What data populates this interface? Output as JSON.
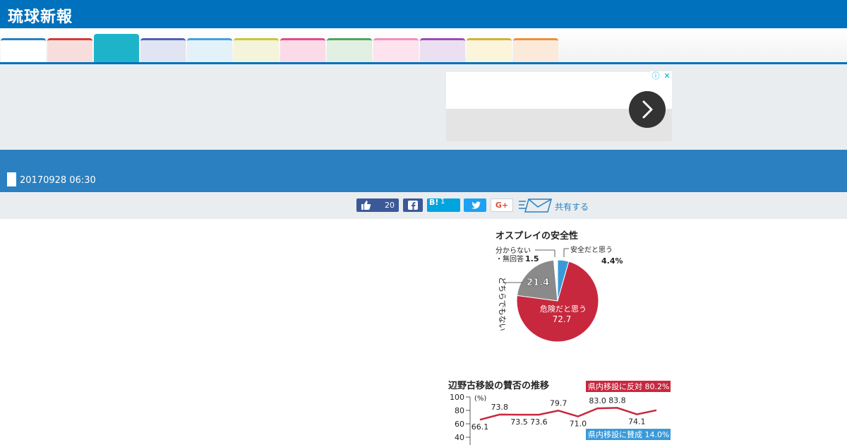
{
  "header": {
    "logo": "琉球新報"
  },
  "nav": {
    "tabs": [
      {
        "color": "#ffffff",
        "border": "#2a80c0"
      },
      {
        "color": "#f7dedd",
        "border": "#d33b3b"
      },
      {
        "color": "#1db4c9",
        "border": "#1db4c9",
        "active": true
      },
      {
        "color": "#e1e4f2",
        "border": "#5062b0"
      },
      {
        "color": "#e3f1f8",
        "border": "#4a9fd6"
      },
      {
        "color": "#f3f4d9",
        "border": "#c8c83a"
      },
      {
        "color": "#fadbe7",
        "border": "#e04c87"
      },
      {
        "color": "#e1f0e3",
        "border": "#4ea85c"
      },
      {
        "color": "#fde3ee",
        "border": "#f190b8"
      },
      {
        "color": "#ebe0f1",
        "border": "#9b4cb6"
      },
      {
        "color": "#fbf5dc",
        "border": "#d2b23a"
      },
      {
        "color": "#fbe9d9",
        "border": "#ea913f"
      }
    ]
  },
  "article": {
    "datetime": "20170928 06:30"
  },
  "share": {
    "like_count": "20",
    "hatena_label": "B!",
    "hatena_count": "1",
    "google_label": "G+",
    "share_label": "共有する"
  },
  "ad": {
    "info_symbol": "ⓘ",
    "close_symbol": "✕"
  },
  "figure1": {
    "title": "オスプレイの安全性",
    "label_dontknow_1": "分からない",
    "label_dontknow_2": "・無回答",
    "value_dontknow": "1.5",
    "label_safe": "安全だと思う",
    "value_safe": "4.4%",
    "label_neither": "どちらでもない",
    "value_neither": "21.4",
    "label_danger": "危険だと思う",
    "value_danger": "72.7",
    "chart_data": {
      "type": "pie",
      "title": "オスプレイの安全性",
      "slices": [
        {
          "label": "安全だと思う",
          "value": 4.4,
          "color": "#3a9ad9"
        },
        {
          "label": "危険だと思う",
          "value": 72.7,
          "color": "#c8283e"
        },
        {
          "label": "どちらでもない",
          "value": 21.4,
          "color": "#8a8a8a"
        },
        {
          "label": "分からない・無回答",
          "value": 1.5,
          "color": "#ffffff"
        }
      ]
    }
  },
  "figure2": {
    "title": "辺野古移設の賛否の推移",
    "unit": "(%)",
    "legend_oppose": "県内移設に反対 80.2%",
    "legend_support": "県内移設に賛成 14.0%",
    "yticks": [
      "100",
      "80",
      "60",
      "40"
    ],
    "chart_data": {
      "type": "line",
      "title": "辺野古移設の賛否の推移",
      "ylabel": "(%)",
      "ylim": [
        40,
        100
      ],
      "series": [
        {
          "name": "県内移設に反対",
          "values": [
            66.1,
            73.8,
            73.5,
            73.6,
            79.7,
            71.0,
            83.0,
            83.8,
            74.1,
            80.2
          ],
          "color": "#c8283e"
        }
      ]
    }
  }
}
